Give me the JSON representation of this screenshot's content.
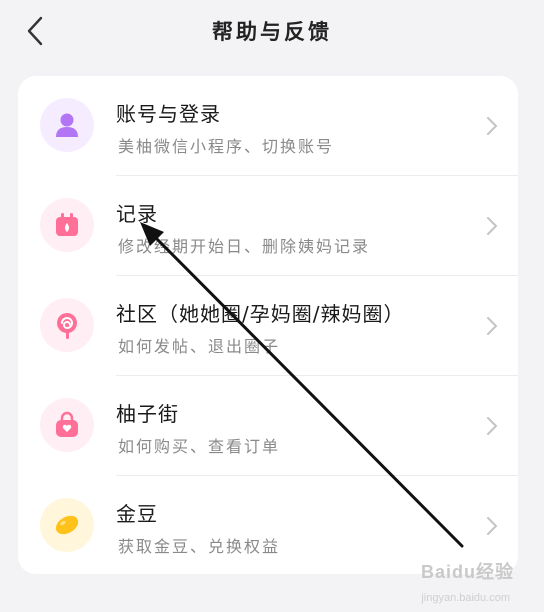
{
  "header": {
    "title": "帮助与反馈",
    "back_icon": "chevron-left-icon"
  },
  "items": [
    {
      "title": "账号与登录",
      "subtitle": "美柚微信小程序、切换账号",
      "icon": "user-icon",
      "icon_bg": "#f6ecff",
      "icon_color": "#b276f5"
    },
    {
      "title": "记录",
      "subtitle": "修改经期开始日、删除姨妈记录",
      "icon": "calendar-icon",
      "icon_bg": "#ffeef3",
      "icon_color": "#ff6f97"
    },
    {
      "title": "社区（她她圈/孕妈圈/辣妈圈）",
      "subtitle": "如何发帖、退出圈子",
      "icon": "lollipop-icon",
      "icon_bg": "#ffeef3",
      "icon_color": "#ff6f97"
    },
    {
      "title": "柚子街",
      "subtitle": "如何购买、查看订单",
      "icon": "shopping-bag-icon",
      "icon_bg": "#ffeef3",
      "icon_color": "#ff6f97"
    },
    {
      "title": "金豆",
      "subtitle": "获取金豆、兑换权益",
      "icon": "bean-icon",
      "icon_bg": "#fff6dc",
      "icon_color": "#ffc21a"
    }
  ],
  "watermark": {
    "text": "Baidu经验",
    "sub": "jingyan.baidu.com"
  },
  "colors": {
    "background": "#f3f3f5",
    "card": "#ffffff",
    "title_text": "#1a1a1a",
    "subtitle_text": "#8a8a8a"
  }
}
